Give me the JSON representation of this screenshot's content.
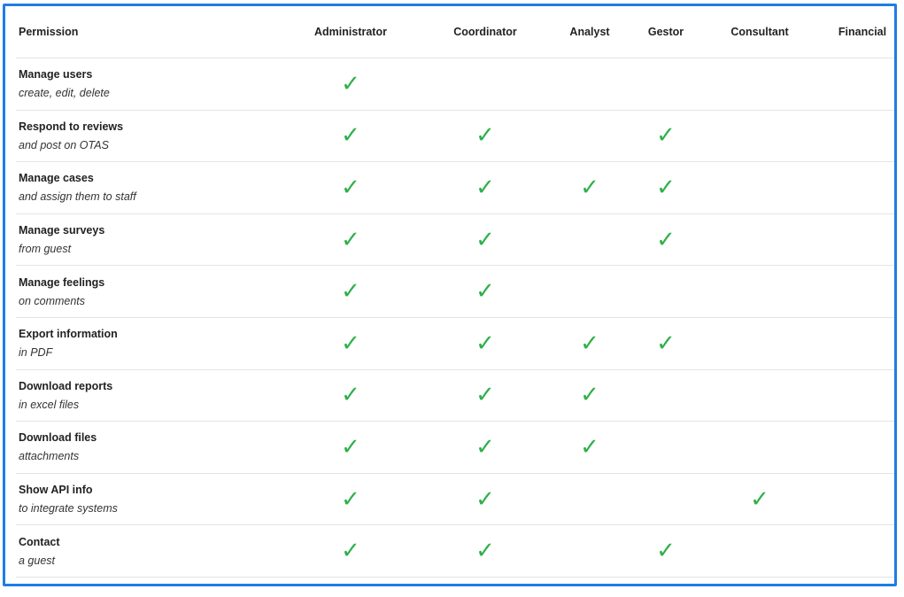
{
  "accent_color": "#1e7de6",
  "check_color": "#2eb04a",
  "check_glyph": "✓",
  "columns": {
    "permission": "Permission",
    "administrator": "Administrator",
    "coordinator": "Coordinator",
    "analyst": "Analyst",
    "gestor": "Gestor",
    "consultant": "Consultant",
    "financial": "Financial"
  },
  "roles": [
    "administrator",
    "coordinator",
    "analyst",
    "gestor",
    "consultant",
    "financial"
  ],
  "rows": [
    {
      "name": "Manage users",
      "desc": "create, edit, delete",
      "granted": {
        "administrator": true,
        "coordinator": false,
        "analyst": false,
        "gestor": false,
        "consultant": false,
        "financial": false
      }
    },
    {
      "name": "Respond to reviews",
      "desc": "and post on OTAS",
      "granted": {
        "administrator": true,
        "coordinator": true,
        "analyst": false,
        "gestor": true,
        "consultant": false,
        "financial": false
      }
    },
    {
      "name": "Manage cases",
      "desc": "and assign them to staff",
      "granted": {
        "administrator": true,
        "coordinator": true,
        "analyst": true,
        "gestor": true,
        "consultant": false,
        "financial": false
      }
    },
    {
      "name": "Manage surveys",
      "desc": "from guest",
      "granted": {
        "administrator": true,
        "coordinator": true,
        "analyst": false,
        "gestor": true,
        "consultant": false,
        "financial": false
      }
    },
    {
      "name": "Manage feelings",
      "desc": "on comments",
      "granted": {
        "administrator": true,
        "coordinator": true,
        "analyst": false,
        "gestor": false,
        "consultant": false,
        "financial": false
      }
    },
    {
      "name": "Export information",
      "desc": "in PDF",
      "granted": {
        "administrator": true,
        "coordinator": true,
        "analyst": true,
        "gestor": true,
        "consultant": false,
        "financial": false
      }
    },
    {
      "name": "Download reports",
      "desc": "in excel files",
      "granted": {
        "administrator": true,
        "coordinator": true,
        "analyst": true,
        "gestor": false,
        "consultant": false,
        "financial": false
      }
    },
    {
      "name": "Download files",
      "desc": "attachments",
      "granted": {
        "administrator": true,
        "coordinator": true,
        "analyst": true,
        "gestor": false,
        "consultant": false,
        "financial": false
      }
    },
    {
      "name": "Show API info",
      "desc": "to integrate systems",
      "granted": {
        "administrator": true,
        "coordinator": true,
        "analyst": false,
        "gestor": false,
        "consultant": true,
        "financial": false
      }
    },
    {
      "name": "Contact",
      "desc": "a guest",
      "granted": {
        "administrator": true,
        "coordinator": true,
        "analyst": false,
        "gestor": true,
        "consultant": false,
        "financial": false
      }
    }
  ]
}
